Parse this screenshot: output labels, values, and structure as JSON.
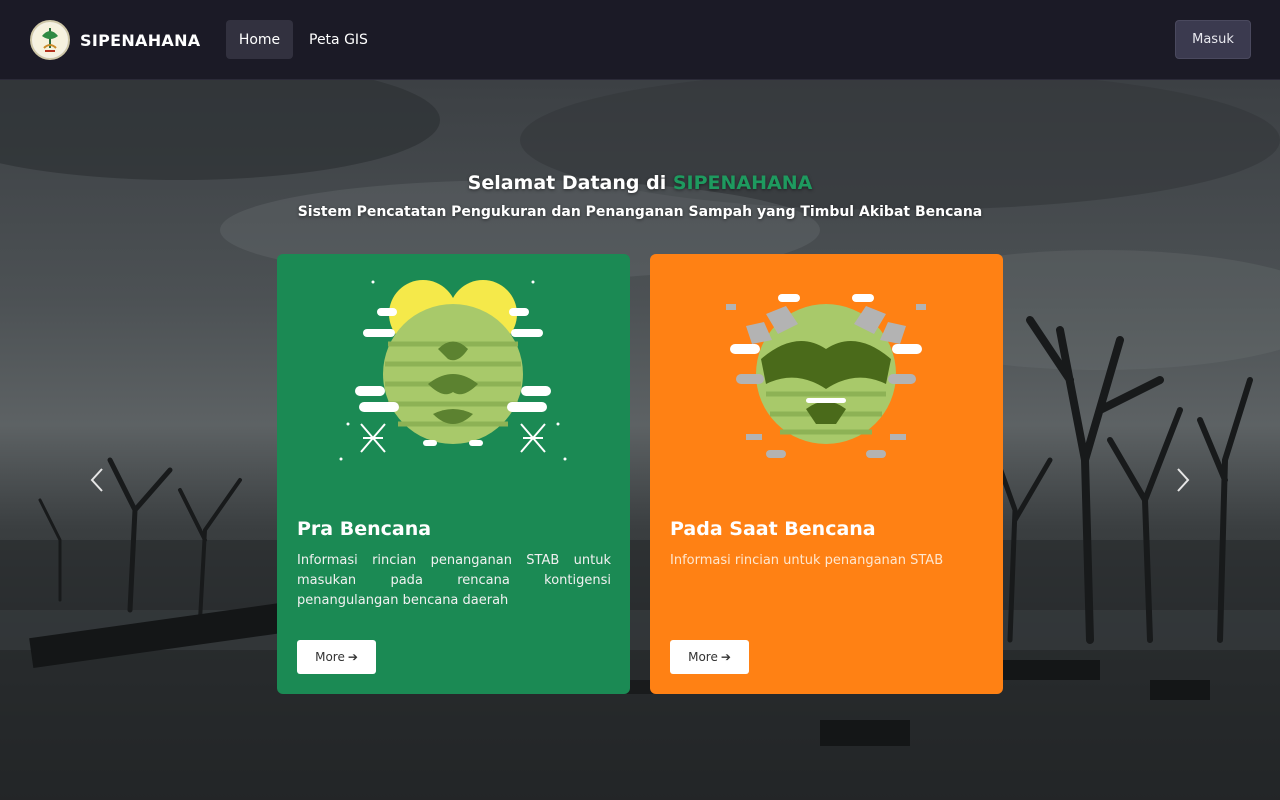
{
  "navbar": {
    "brand": "SIPENAHANA",
    "links": [
      "Home",
      "Peta GIS"
    ],
    "login_label": "Masuk"
  },
  "hero": {
    "welcome_prefix": "Selamat Datang di",
    "welcome_accent": "SIPENAHANA",
    "subtitle": "Sistem Pencatatan Pengukuran dan Penanganan Sampah yang Timbul Akibat Bencana"
  },
  "cards": [
    {
      "title": "Pra Bencana",
      "description": "Informasi rincian penanganan STAB untuk masukan pada rencana kontigensi penangulangan bencana daerah",
      "button": "More",
      "color": "#1b8a54"
    },
    {
      "title": "Pada Saat Bencana",
      "description": "Informasi rincian untuk penanganan STAB",
      "button": "More",
      "color": "#ff8114"
    }
  ],
  "colors": {
    "navbar": "#1b1a26",
    "accent": "#1e9a5f",
    "login_button": "#3b3a4f"
  },
  "icons": [
    "logo-emblem-icon",
    "chevron-left-icon",
    "chevron-right-icon",
    "arrow-right-icon"
  ]
}
